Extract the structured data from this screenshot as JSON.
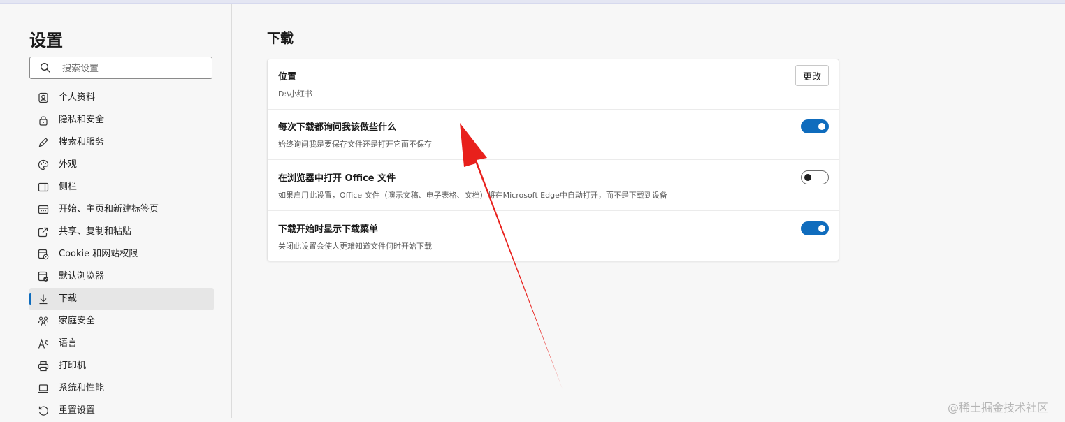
{
  "sidebar": {
    "title": "设置",
    "search_placeholder": "搜索设置",
    "items": [
      {
        "label": "个人资料",
        "icon": "profile-icon",
        "active": false
      },
      {
        "label": "隐私和安全",
        "icon": "lock-icon",
        "active": false
      },
      {
        "label": "搜索和服务",
        "icon": "pen-icon",
        "active": false
      },
      {
        "label": "外观",
        "icon": "palette-icon",
        "active": false
      },
      {
        "label": "侧栏",
        "icon": "sidebar-panel-icon",
        "active": false
      },
      {
        "label": "开始、主页和新建标签页",
        "icon": "home-tabs-icon",
        "active": false
      },
      {
        "label": "共享、复制和粘贴",
        "icon": "share-icon",
        "active": false
      },
      {
        "label": "Cookie 和网站权限",
        "icon": "cookie-permissions-icon",
        "active": false
      },
      {
        "label": "默认浏览器",
        "icon": "default-browser-icon",
        "active": false
      },
      {
        "label": "下载",
        "icon": "download-icon",
        "active": true
      },
      {
        "label": "家庭安全",
        "icon": "family-icon",
        "active": false
      },
      {
        "label": "语言",
        "icon": "language-icon",
        "active": false
      },
      {
        "label": "打印机",
        "icon": "printer-icon",
        "active": false
      },
      {
        "label": "系统和性能",
        "icon": "laptop-icon",
        "active": false
      },
      {
        "label": "重置设置",
        "icon": "reset-icon",
        "active": false
      }
    ]
  },
  "main": {
    "title": "下载",
    "location": {
      "title": "位置",
      "path": "D:\\小红书",
      "change_label": "更改"
    },
    "settings": [
      {
        "title": "每次下载都询问我该做些什么",
        "description": "始终询问我是要保存文件还是打开它而不保存",
        "enabled": true
      },
      {
        "title": "在浏览器中打开 Office 文件",
        "description": "如果启用此设置，Office 文件（演示文稿、电子表格、文档）将在Microsoft Edge中自动打开，而不是下载到设备",
        "enabled": false
      },
      {
        "title": "下载开始时显示下载菜单",
        "description": "关闭此设置会使人更难知道文件何时开始下载",
        "enabled": true
      }
    ]
  },
  "annotation": {
    "color": "#e8201c"
  },
  "watermark": "@稀土掘金技术社区",
  "colors": {
    "accent": "#0f6cbd",
    "background": "#f7f7f7"
  }
}
